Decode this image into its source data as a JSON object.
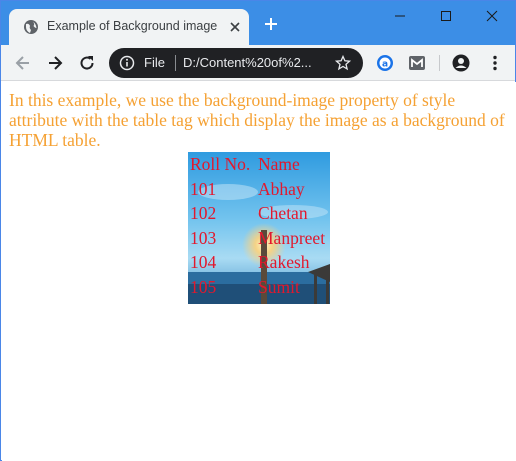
{
  "browser": {
    "tab_title": "Example of Background image",
    "address_scheme": "File",
    "address_url": "D:/Content%20of%2...",
    "accent": "#3c8ee6",
    "omnibox_bg": "#202124"
  },
  "page": {
    "paragraph": "In this example, we use the background-image property of style attribute with the table tag which display the image as a background of HTML table.",
    "paragraph_color": "#f5a133",
    "table_text_color": "#e2182d",
    "table": {
      "headers": [
        "Roll No.",
        "Name"
      ],
      "rows": [
        [
          "101",
          "Abhay"
        ],
        [
          "102",
          "Chetan"
        ],
        [
          "103",
          "Manpreet"
        ],
        [
          "104",
          "Rakesh"
        ],
        [
          "105",
          "Sumit"
        ]
      ]
    }
  }
}
